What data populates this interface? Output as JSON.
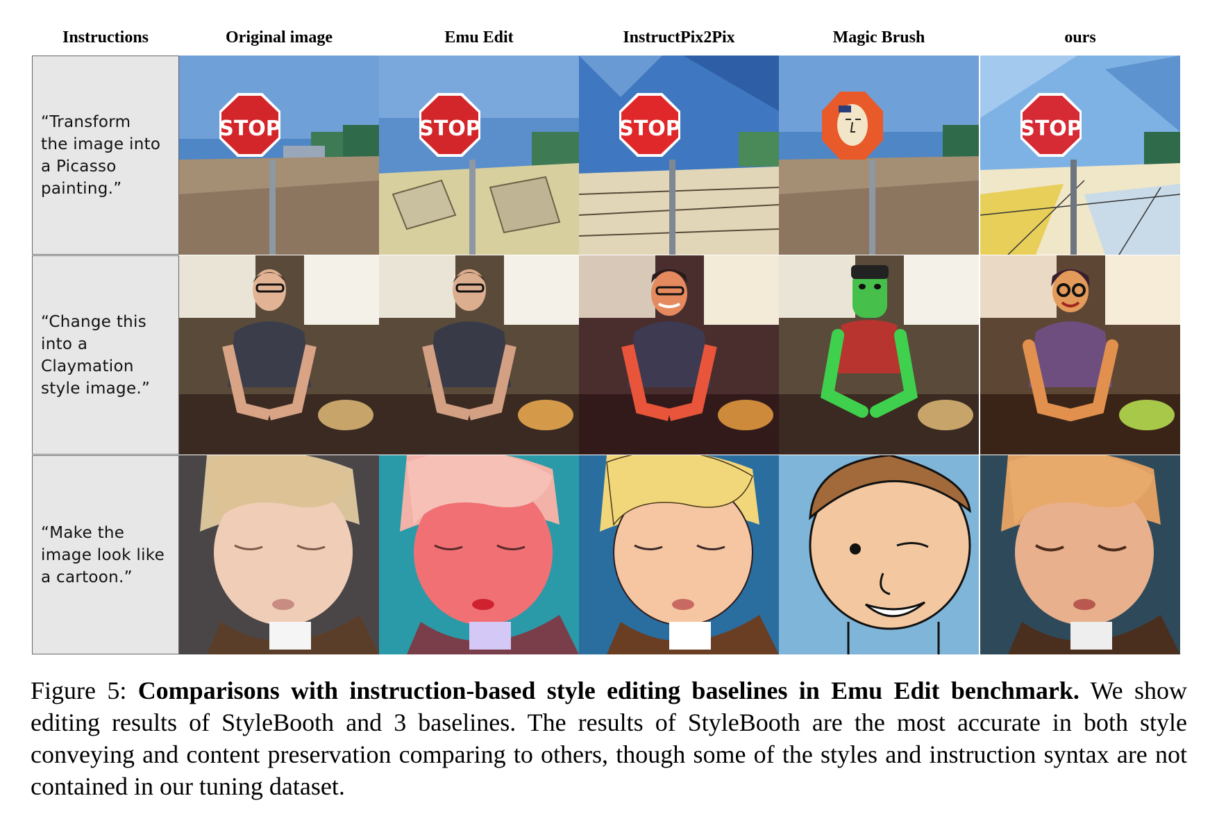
{
  "columns": [
    "Instructions",
    "Original image",
    "Emu Edit",
    "InstructPix2Pix",
    "Magic Brush",
    "ours"
  ],
  "rows": [
    {
      "instruction": "“Transform\nthe image into\na Picasso\npainting.”"
    },
    {
      "instruction": "“Change this\ninto a\nClaymation\nstyle image.”"
    },
    {
      "instruction": "“Make the\nimage look like\na cartoon.”"
    }
  ],
  "stop_sign_text": "STOP",
  "caption": {
    "label": "Figure 5:",
    "title": "Comparisons with instruction-based style editing baselines in Emu Edit benchmark.",
    "body": "We show editing results of StyleBooth and 3 baselines. The results of StyleBooth are the most accurate in both style conveying and content preservation comparing to others, though some of the styles and instruction syntax are not contained in our tuning dataset."
  },
  "colors": {
    "instruction_bg": "#e7e7e7",
    "sky": "#4f86c6",
    "stop_red": "#d3262b"
  }
}
